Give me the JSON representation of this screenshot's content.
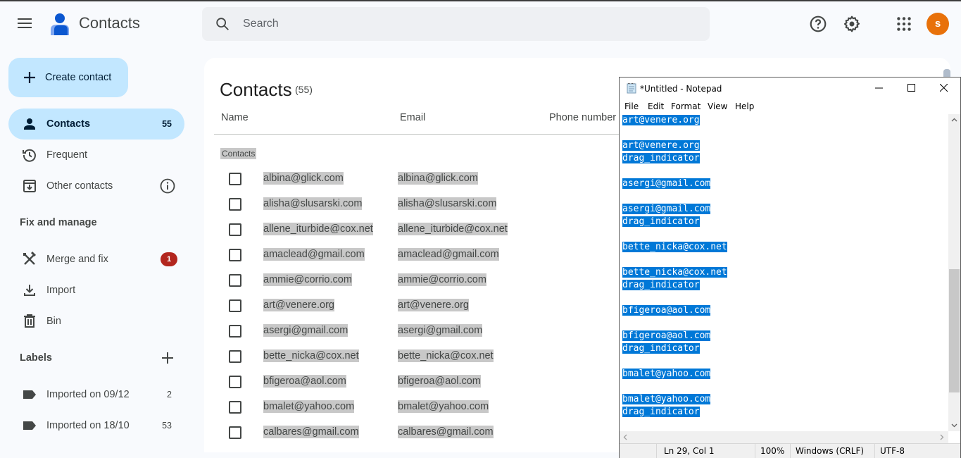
{
  "header": {
    "app_title": "Contacts",
    "search_placeholder": "Search",
    "avatar_initial": "s",
    "avatar_color": "#e8710a"
  },
  "sidebar": {
    "create_label": "Create contact",
    "items": [
      {
        "label": "Contacts",
        "count": "55",
        "icon": "person-icon",
        "active": true
      },
      {
        "label": "Frequent",
        "count": "",
        "icon": "history-icon"
      },
      {
        "label": "Other contacts",
        "count": "",
        "icon": "archive-download-icon"
      }
    ],
    "fix_manage_header": "Fix and manage",
    "fix_items": [
      {
        "label": "Merge and fix",
        "badge": "1",
        "icon": "merge-fix-icon"
      },
      {
        "label": "Import",
        "icon": "download-icon"
      },
      {
        "label": "Bin",
        "icon": "trash-icon"
      }
    ],
    "labels_header": "Labels",
    "labels": [
      {
        "label": "Imported on 09/12",
        "count": "2"
      },
      {
        "label": "Imported on 18/10",
        "count": "53"
      }
    ]
  },
  "main": {
    "title": "Contacts",
    "count": "(55)",
    "columns": [
      "Name",
      "Email",
      "Phone number"
    ],
    "group_label": "Contacts",
    "rows": [
      {
        "name": "albina@glick.com",
        "email": "albina@glick.com"
      },
      {
        "name": "alisha@slusarski.com",
        "email": "alisha@slusarski.com"
      },
      {
        "name": "allene_iturbide@cox.net",
        "email": "allene_iturbide@cox.net"
      },
      {
        "name": "amaclead@gmail.com",
        "email": "amaclead@gmail.com"
      },
      {
        "name": "ammie@corrio.com",
        "email": "ammie@corrio.com"
      },
      {
        "name": "art@venere.org",
        "email": "art@venere.org"
      },
      {
        "name": "asergi@gmail.com",
        "email": "asergi@gmail.com"
      },
      {
        "name": "bette_nicka@cox.net",
        "email": "bette_nicka@cox.net"
      },
      {
        "name": "bfigeroa@aol.com",
        "email": "bfigeroa@aol.com"
      },
      {
        "name": "bmalet@yahoo.com",
        "email": "bmalet@yahoo.com"
      },
      {
        "name": "calbares@gmail.com",
        "email": "calbares@gmail.com"
      }
    ]
  },
  "notepad": {
    "title": "*Untitled - Notepad",
    "menu": [
      "File",
      "Edit",
      "Format",
      "View",
      "Help"
    ],
    "lines": [
      "art@venere.org",
      "",
      "art@venere.org",
      "drag_indicator",
      "",
      "asergi@gmail.com",
      "",
      "asergi@gmail.com",
      "drag_indicator",
      "",
      "bette_nicka@cox.net",
      "",
      "bette_nicka@cox.net",
      "drag_indicator",
      "",
      "bfigeroa@aol.com",
      "",
      "bfigeroa@aol.com",
      "drag_indicator",
      "",
      "bmalet@yahoo.com",
      "",
      "bmalet@yahoo.com",
      "drag_indicator",
      ""
    ],
    "status": {
      "position": "Ln 29, Col 1",
      "zoom": "100%",
      "line_ending": "Windows (CRLF)",
      "encoding": "UTF-8"
    }
  }
}
